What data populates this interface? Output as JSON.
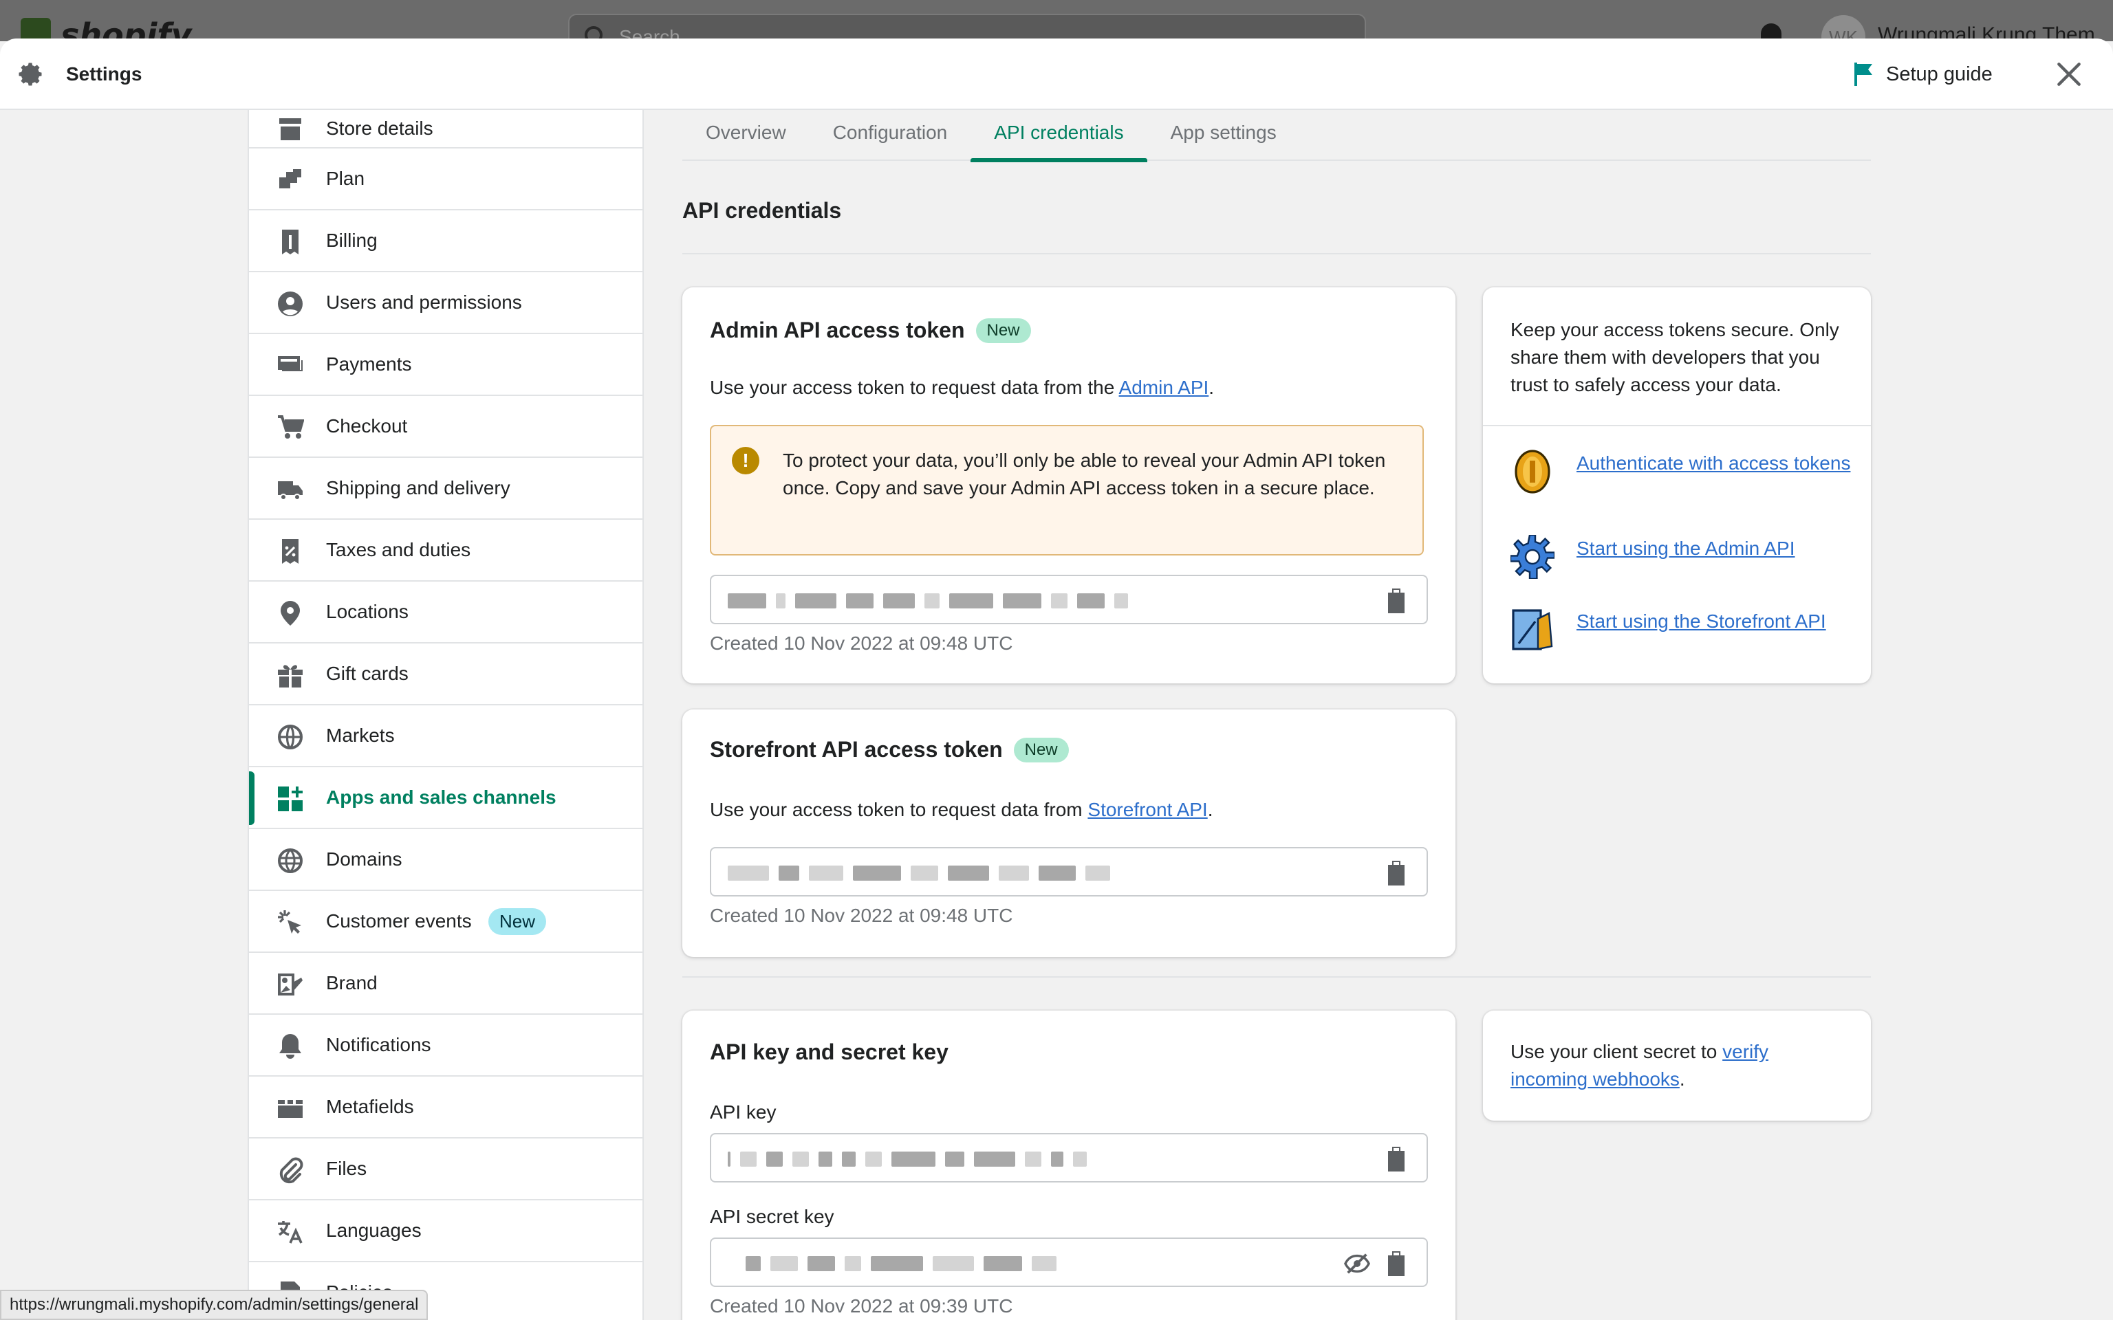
{
  "backdrop": {
    "logo_text": "shopify",
    "search_placeholder": "Search",
    "avatar_initials": "WK",
    "user_name": "Wrungmali Krung Them"
  },
  "header": {
    "title": "Settings",
    "setup_guide_label": "Setup guide"
  },
  "sidebar": {
    "items": [
      {
        "label": "Store details",
        "icon": "store-icon"
      },
      {
        "label": "Plan",
        "icon": "plan-icon"
      },
      {
        "label": "Billing",
        "icon": "billing-icon"
      },
      {
        "label": "Users and permissions",
        "icon": "user-icon"
      },
      {
        "label": "Payments",
        "icon": "payments-icon"
      },
      {
        "label": "Checkout",
        "icon": "cart-icon"
      },
      {
        "label": "Shipping and delivery",
        "icon": "truck-icon"
      },
      {
        "label": "Taxes and duties",
        "icon": "tax-icon"
      },
      {
        "label": "Locations",
        "icon": "location-pin-icon"
      },
      {
        "label": "Gift cards",
        "icon": "gift-icon"
      },
      {
        "label": "Markets",
        "icon": "markets-icon"
      },
      {
        "label": "Apps and sales channels",
        "icon": "apps-icon",
        "active": true
      },
      {
        "label": "Domains",
        "icon": "globe-icon"
      },
      {
        "label": "Customer events",
        "icon": "cursor-click-icon",
        "badge": "New"
      },
      {
        "label": "Brand",
        "icon": "brand-icon"
      },
      {
        "label": "Notifications",
        "icon": "bell-icon"
      },
      {
        "label": "Metafields",
        "icon": "metafields-icon"
      },
      {
        "label": "Files",
        "icon": "paperclip-icon"
      },
      {
        "label": "Languages",
        "icon": "translate-icon"
      },
      {
        "label": "Policies",
        "icon": "policies-icon"
      }
    ]
  },
  "tabs": [
    "Overview",
    "Configuration",
    "API credentials",
    "App settings"
  ],
  "active_tab": "API credentials",
  "section_title": "API credentials",
  "admin_token": {
    "title": "Admin API access token",
    "badge": "New",
    "desc_prefix": "Use your access token to request data from the ",
    "desc_link": "Admin API",
    "desc_suffix": ".",
    "warning": "To protect your data, you’ll only be able to reveal your Admin API token once. Copy and save your Admin API access token in a secure place.",
    "created": "Created 10 Nov 2022 at 09:48 UTC"
  },
  "storefront_token": {
    "title": "Storefront API access token",
    "badge": "New",
    "desc_prefix": "Use your access token to request data from ",
    "desc_link": "Storefront API",
    "desc_suffix": ".",
    "created": "Created 10 Nov 2022 at 09:48 UTC"
  },
  "security_card": {
    "text": "Keep your access tokens secure. Only share them with developers that you trust to safely access your data.",
    "links": [
      {
        "label": "Authenticate with access tokens",
        "icon": "coin-icon"
      },
      {
        "label": "Start using the Admin API",
        "icon": "gear-pixel-icon"
      },
      {
        "label": "Start using the Storefront API",
        "icon": "storefront-pixel-icon"
      }
    ]
  },
  "keys": {
    "title": "API key and secret key",
    "api_key_label": "API key",
    "secret_label": "API secret key",
    "created": "Created 10 Nov 2022 at 09:39 UTC"
  },
  "webhook_card": {
    "prefix": "Use your client secret to ",
    "link": "verify incoming webhooks",
    "suffix": "."
  },
  "status_url": "https://wrungmali.myshopify.com/admin/settings/general",
  "colors": {
    "accent": "#008060",
    "link": "#2c6ecb",
    "badge_green": "#aee9d1",
    "badge_blue": "#a4e8f2",
    "warning_bg": "#fff5ea"
  }
}
